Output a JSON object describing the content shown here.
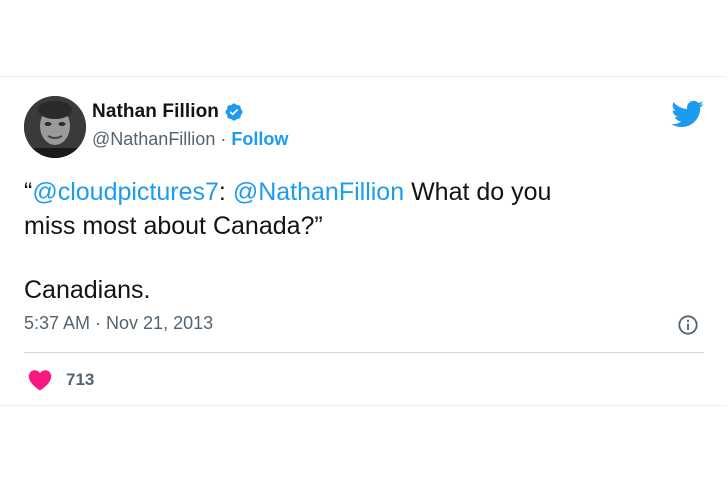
{
  "tweet": {
    "author": {
      "name": "Nathan Fillion",
      "handle": "@NathanFillion",
      "separator": "·",
      "follow_label": "Follow",
      "verified": true
    },
    "text": {
      "open_quote": "“",
      "mention_1": "@cloudpictures7",
      "colon": ":",
      "mention_2": "@NathanFillion",
      "line1_rest": " What do you",
      "line2": "miss most about Canada?”",
      "reply": "Canadians."
    },
    "timestamp": "5:37 AM · Nov 21, 2013",
    "likes": "713",
    "icons": {
      "platform": "twitter-bird-icon",
      "verified": "verified-badge-icon",
      "info": "info-icon",
      "like": "heart-icon"
    },
    "colors": {
      "accent": "#1d9bf0",
      "heart": "#f91880",
      "text": "#0f1419",
      "muted": "#536471"
    }
  }
}
